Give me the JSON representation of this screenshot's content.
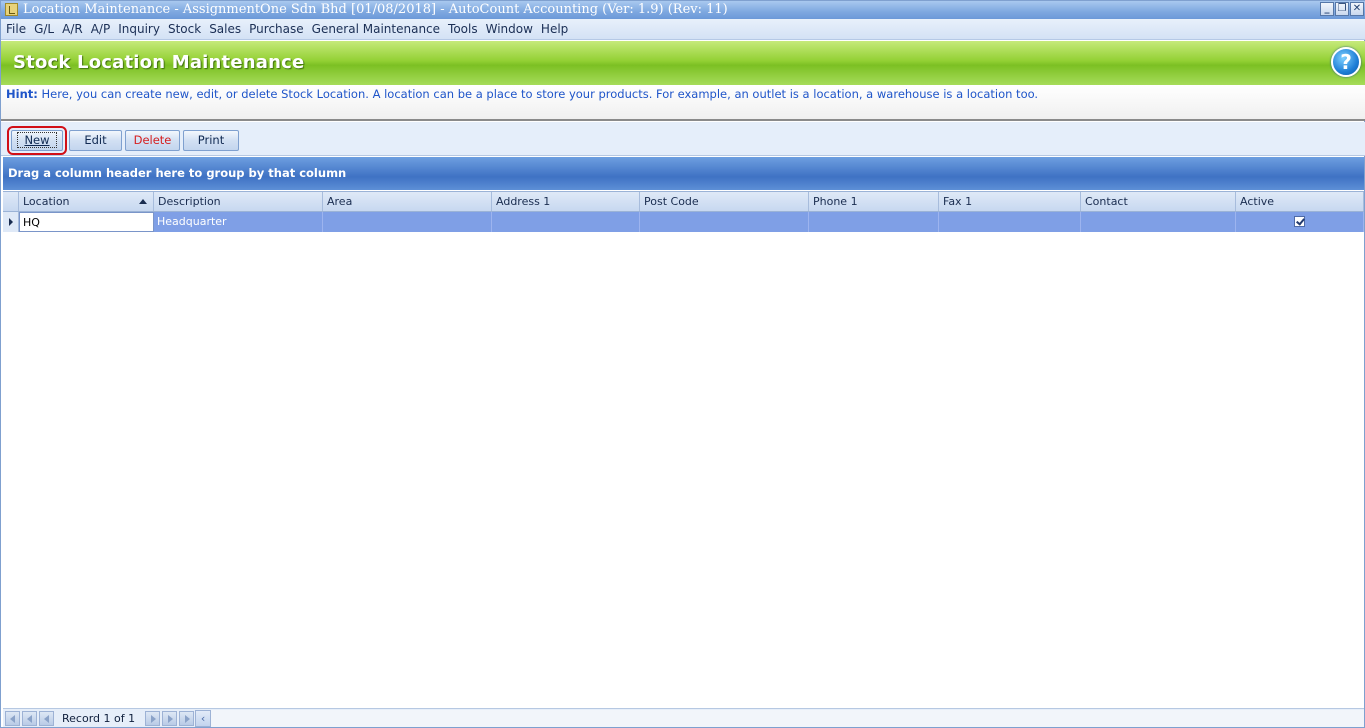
{
  "window": {
    "title": "Location Maintenance - AssignmentOne Sdn Bhd [01/08/2018] - AutoCount Accounting (Ver: 1.9) (Rev: 11)",
    "controls": [
      "minimize",
      "restore",
      "close"
    ]
  },
  "menu": {
    "items": [
      "File",
      "G/L",
      "A/R",
      "A/P",
      "Inquiry",
      "Stock",
      "Sales",
      "Purchase",
      "General Maintenance",
      "Tools",
      "Window",
      "Help"
    ]
  },
  "banner": {
    "title": "Stock Location Maintenance",
    "help_icon": "question-mark",
    "help_glyph": "?"
  },
  "hint": {
    "label": "Hint:",
    "text": "Here, you can create new, edit, or delete Stock Location. A location can be a place to store your products. For example, an outlet is a location, a warehouse is a location too."
  },
  "toolbar": {
    "new_label": "New",
    "edit_label": "Edit",
    "delete_label": "Delete",
    "print_label": "Print"
  },
  "grid": {
    "group_panel_text": "Drag a column header here to group by that column",
    "columns": [
      "Location",
      "Description",
      "Area",
      "Address 1",
      "Post Code",
      "Phone 1",
      "Fax 1",
      "Contact",
      "Active"
    ],
    "rows": [
      {
        "location": "HQ",
        "description": "Headquarter",
        "area": "",
        "address1": "",
        "post_code": "",
        "phone1": "",
        "fax1": "",
        "contact": "",
        "active": true
      }
    ]
  },
  "navigator": {
    "record_text": "Record 1 of 1"
  },
  "colors": {
    "banner_green": "#8ccc2c",
    "selected_row": "#7f9fe6",
    "group_panel": "#3f72c4",
    "hint_text": "#1f55c9",
    "highlight_outline": "#d10f17"
  }
}
